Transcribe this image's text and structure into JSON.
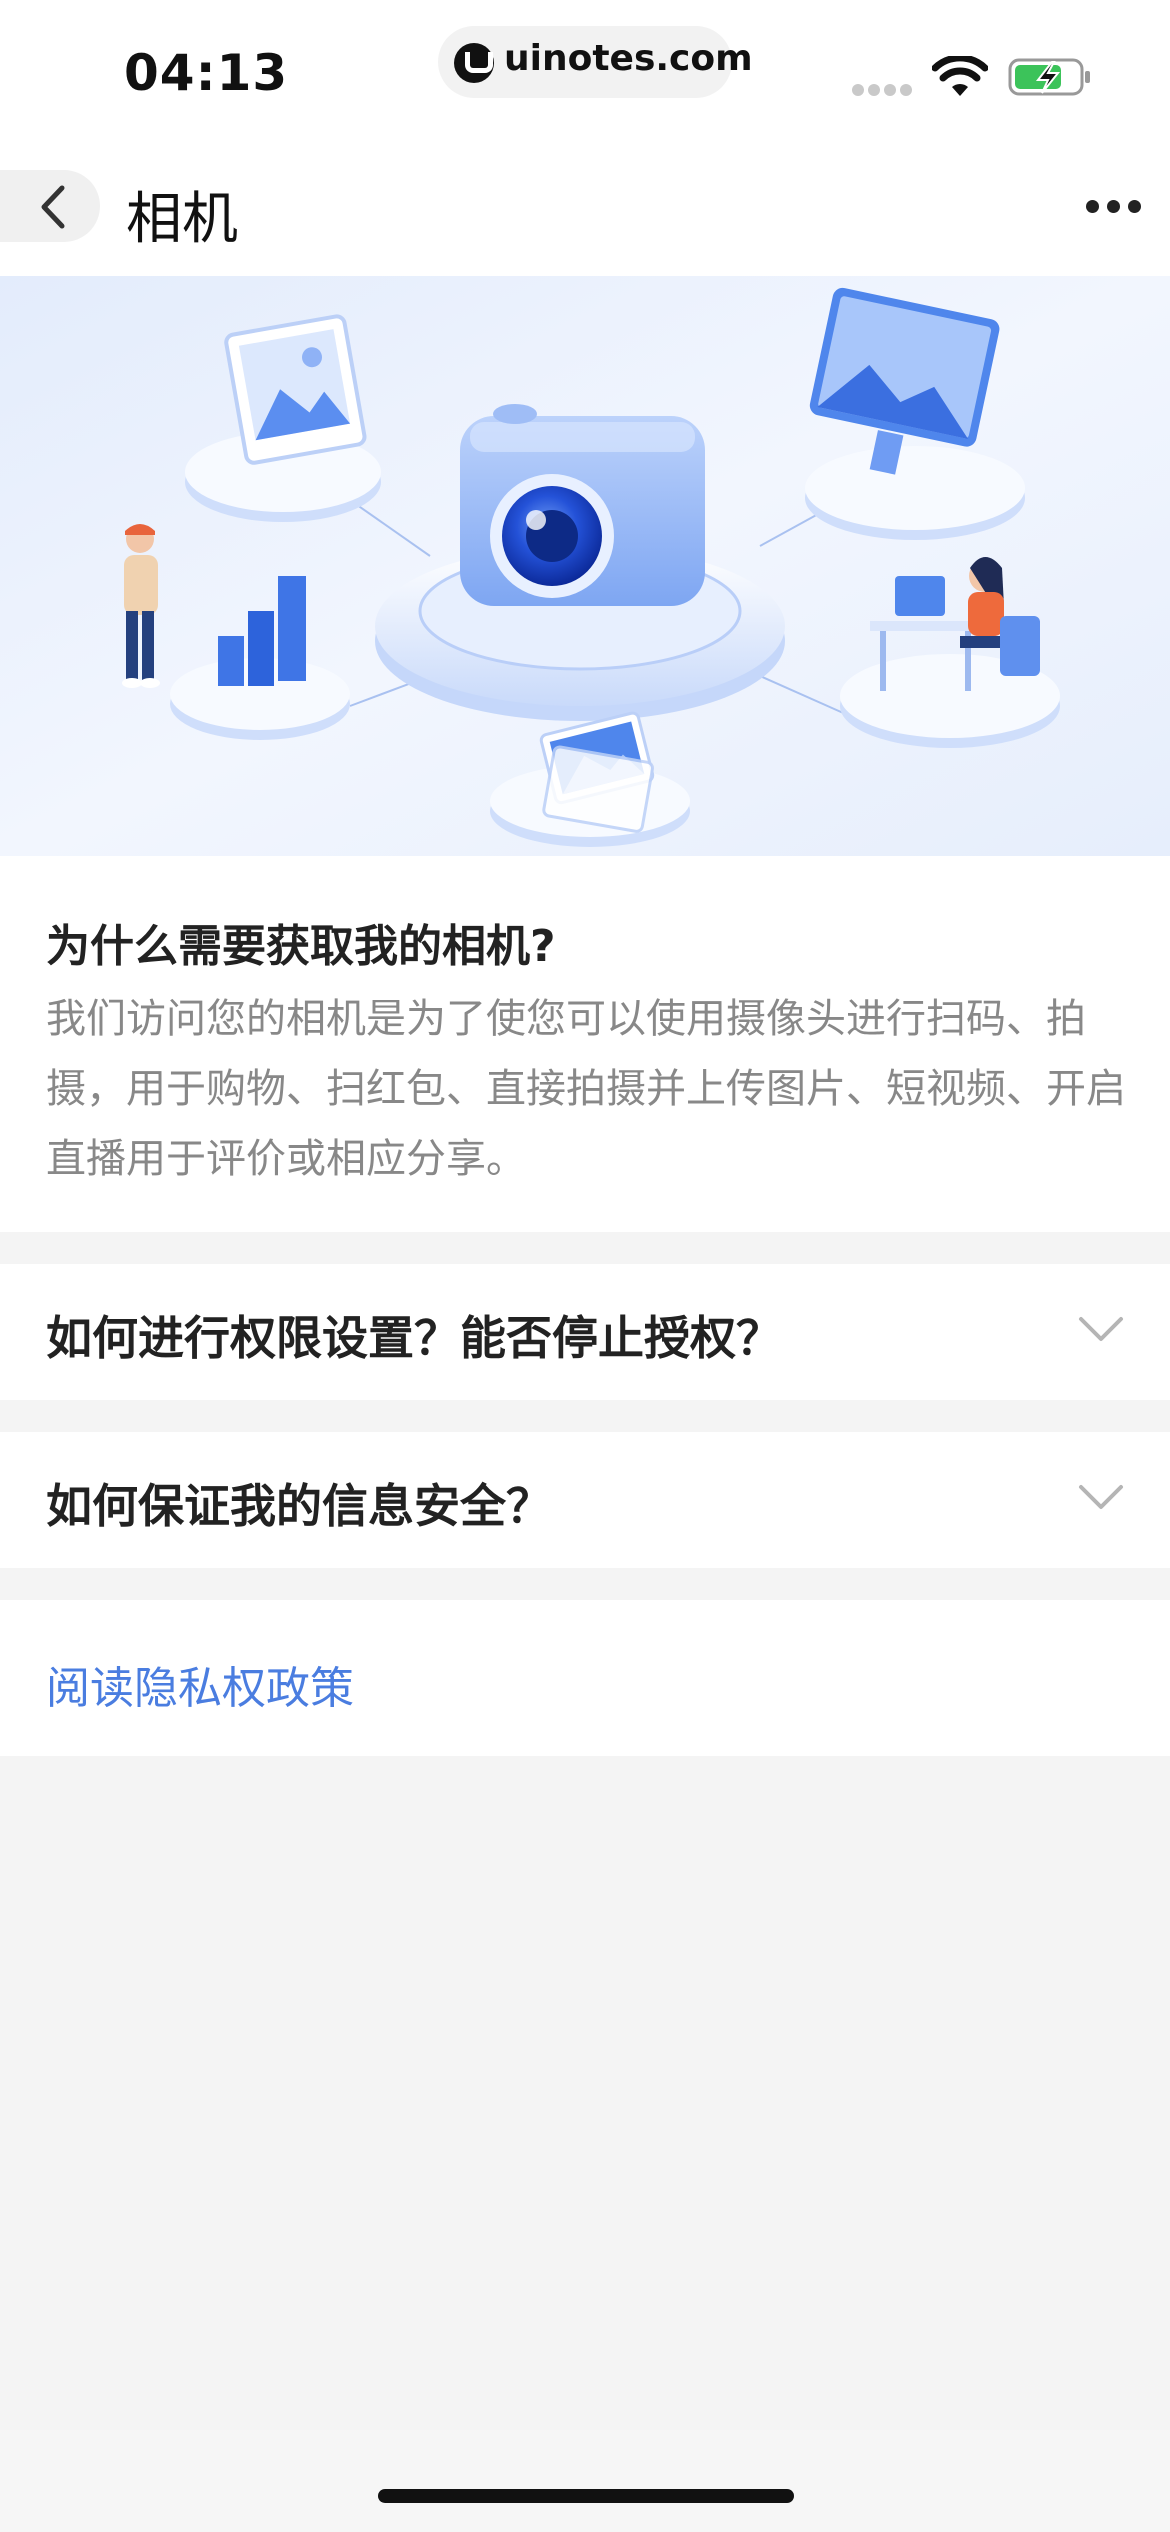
{
  "status_bar": {
    "time": "04:13",
    "site": "uinotes.com",
    "icons": [
      "signal-icon",
      "wifi-icon",
      "battery-charging-icon"
    ]
  },
  "nav": {
    "back_icon": "chevron-left-icon",
    "title": "相机",
    "more_icon": "more-dots-icon"
  },
  "hero": {
    "illustration": "camera-permission-illustration"
  },
  "why": {
    "title": "为什么需要获取我的相机?",
    "body": "我们访问您的相机是为了使您可以使用摄像头进行扫码、拍摄，用于购物、扫红包、直接拍摄并上传图片、短视频、开启直播用于评价或相应分享。"
  },
  "faq": [
    {
      "question": "如何进行权限设置？能否停止授权？",
      "icon": "chevron-down-icon"
    },
    {
      "question": "如何保证我的信息安全？",
      "icon": "chevron-down-icon"
    }
  ],
  "policy": {
    "link_label": "阅读隐私权政策"
  },
  "colors": {
    "link": "#4a7de0",
    "background": "#f4f4f4",
    "card": "#ffffff",
    "body_text": "#888888"
  }
}
